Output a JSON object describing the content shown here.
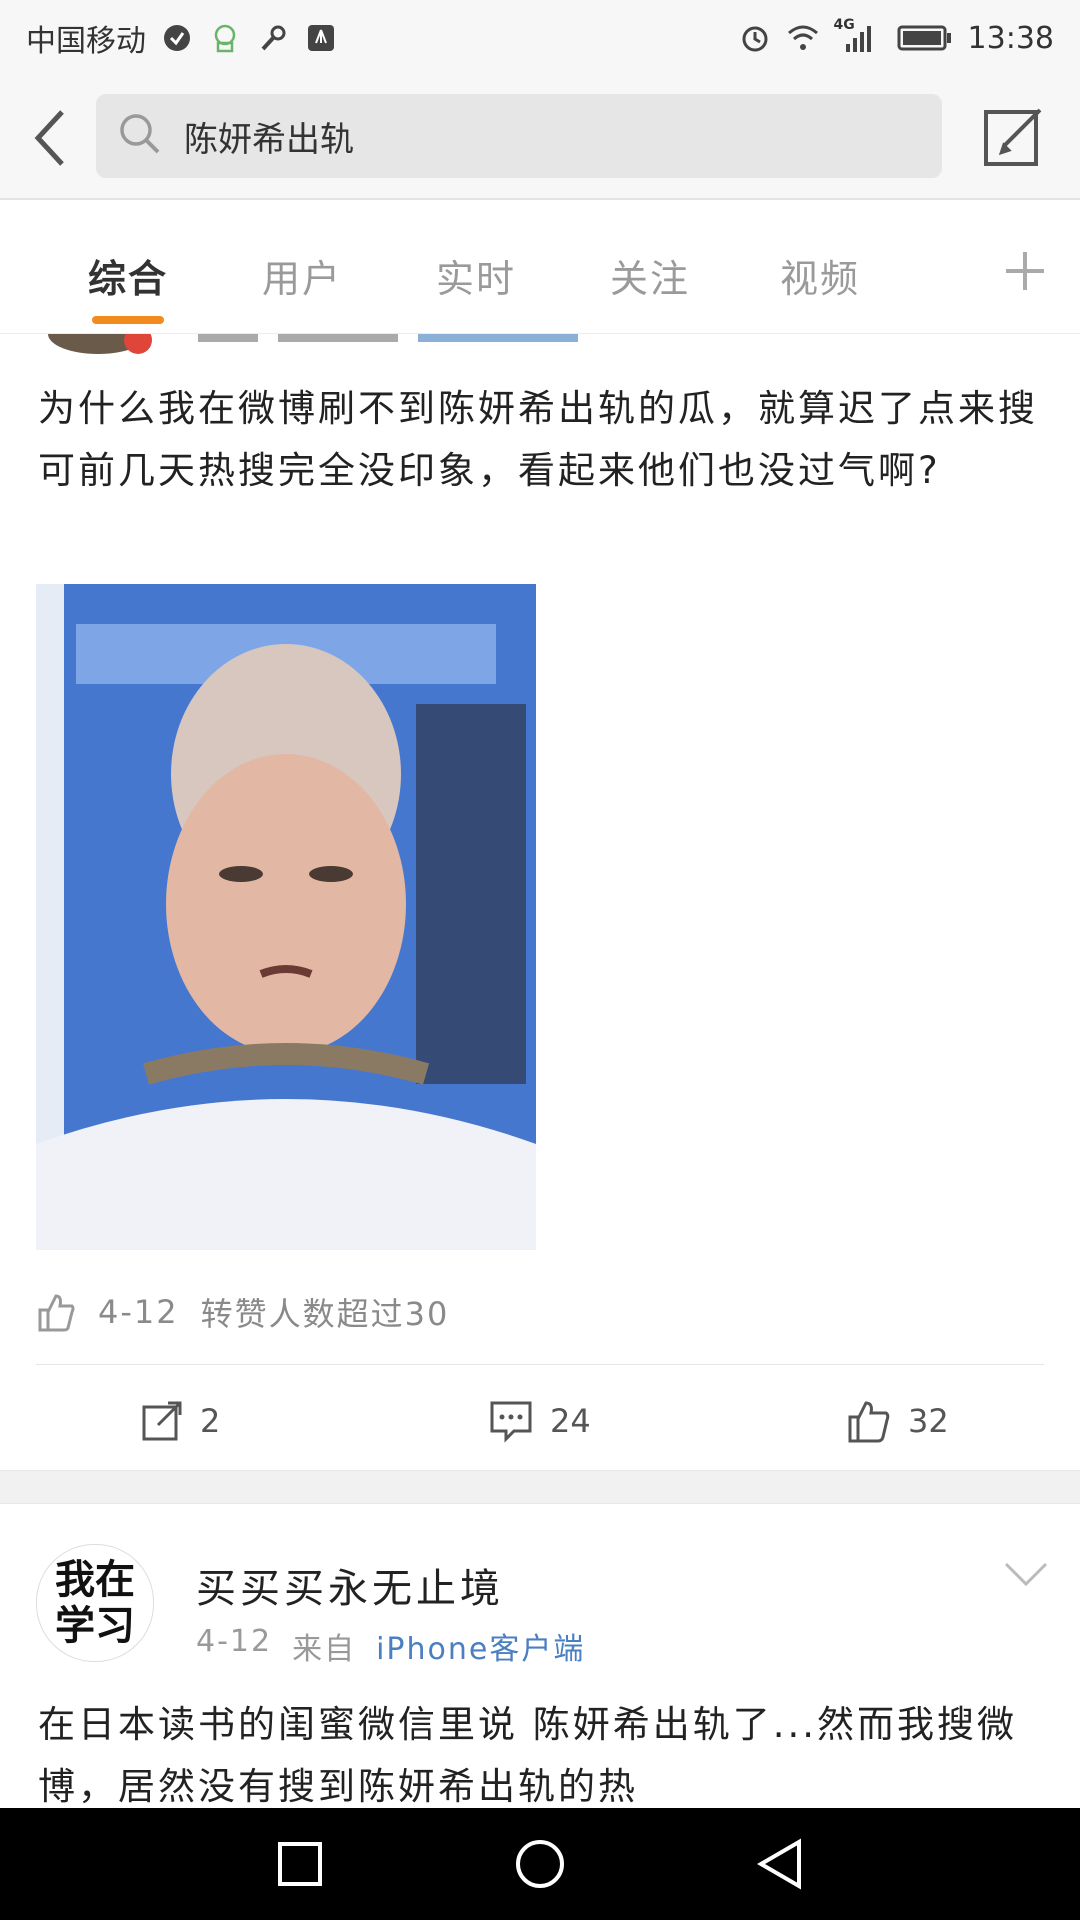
{
  "status_bar": {
    "carrier": "中国移动",
    "network": "4G",
    "time": "13:38",
    "icons": [
      "notification-icon",
      "chat-icon",
      "key-icon",
      "huawei-icon",
      "alarm-icon",
      "wifi-icon",
      "signal-icon",
      "battery-icon"
    ]
  },
  "search": {
    "query": "陈妍希出轨",
    "icons": [
      "back-arrow-icon",
      "search-icon",
      "compose-icon"
    ]
  },
  "tabs": [
    {
      "label": "综合"
    },
    {
      "label": "用户"
    },
    {
      "label": "实时"
    },
    {
      "label": "关注"
    },
    {
      "label": "视频"
    }
  ],
  "post1": {
    "text": "为什么我在微博刷不到陈妍希出轨的瓜，就算迟了点来搜可前几天热搜完全没印象，看起来他们也没过气啊?",
    "like_note_date": "4-12",
    "like_note_text": "转赞人数超过30",
    "reposts": "2",
    "comments": "24",
    "likes": "32"
  },
  "post2": {
    "avatar_line1": "我在",
    "avatar_line2": "学习",
    "username": "买买买永无止境",
    "date": "4-12",
    "from_label": "来自",
    "source": "iPhone客户端",
    "text": "在日本读书的闺蜜微信里说 陈妍希出轨了...然而我搜微博，居然没有搜到陈妍希出轨的热"
  },
  "colors": {
    "accent_underline": "#f28b1e",
    "source_link": "#4a7fc1",
    "nav_bar": "#000000"
  }
}
